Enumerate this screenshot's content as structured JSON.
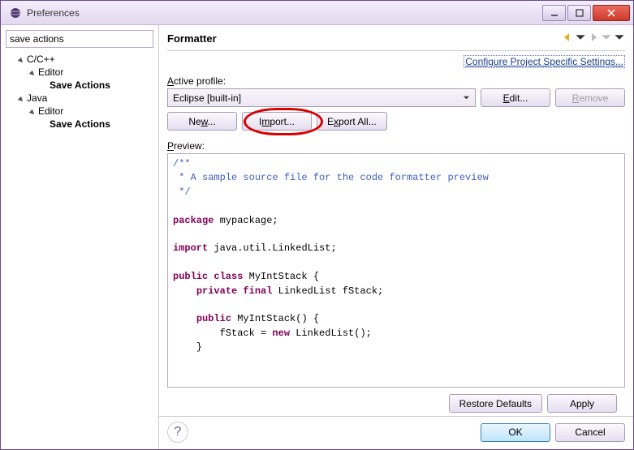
{
  "window": {
    "title": "Preferences"
  },
  "sidebar": {
    "filter_value": "save actions",
    "tree": [
      {
        "label": "C/C++",
        "children": [
          {
            "label": "Editor",
            "children": [
              {
                "label": "Save Actions",
                "bold": true
              }
            ]
          }
        ]
      },
      {
        "label": "Java",
        "children": [
          {
            "label": "Editor",
            "children": [
              {
                "label": "Save Actions",
                "bold": true
              }
            ]
          }
        ]
      }
    ]
  },
  "page": {
    "title": "Formatter",
    "config_link": "Configure Project Specific Settings...",
    "active_profile_label": "Active profile:",
    "active_profile_value": "Eclipse [built-in]",
    "buttons": {
      "edit": "Edit...",
      "remove": "Remove",
      "new": "New...",
      "import": "Import...",
      "export_all": "Export All..."
    },
    "preview_label": "Preview:",
    "preview_tokens": [
      {
        "t": "com",
        "v": "/**"
      },
      {
        "t": "nl"
      },
      {
        "t": "com",
        "v": " * A sample source file for the code formatter preview"
      },
      {
        "t": "nl"
      },
      {
        "t": "com",
        "v": " */"
      },
      {
        "t": "nl"
      },
      {
        "t": "nl"
      },
      {
        "t": "kw",
        "v": "package"
      },
      {
        "t": "plain",
        "v": " mypackage;"
      },
      {
        "t": "nl"
      },
      {
        "t": "nl"
      },
      {
        "t": "kw",
        "v": "import"
      },
      {
        "t": "plain",
        "v": " java.util.LinkedList;"
      },
      {
        "t": "nl"
      },
      {
        "t": "nl"
      },
      {
        "t": "kw",
        "v": "public class"
      },
      {
        "t": "plain",
        "v": " MyIntStack {"
      },
      {
        "t": "nl"
      },
      {
        "t": "plain",
        "v": "    "
      },
      {
        "t": "kw",
        "v": "private final"
      },
      {
        "t": "plain",
        "v": " LinkedList fStack;"
      },
      {
        "t": "nl"
      },
      {
        "t": "nl"
      },
      {
        "t": "plain",
        "v": "    "
      },
      {
        "t": "kw",
        "v": "public"
      },
      {
        "t": "plain",
        "v": " MyIntStack() {"
      },
      {
        "t": "nl"
      },
      {
        "t": "plain",
        "v": "        fStack = "
      },
      {
        "t": "kw",
        "v": "new"
      },
      {
        "t": "plain",
        "v": " LinkedList();"
      },
      {
        "t": "nl"
      },
      {
        "t": "plain",
        "v": "    }"
      },
      {
        "t": "nl"
      }
    ]
  },
  "footer": {
    "restore_defaults": "Restore Defaults",
    "apply": "Apply",
    "ok": "OK",
    "cancel": "Cancel"
  }
}
